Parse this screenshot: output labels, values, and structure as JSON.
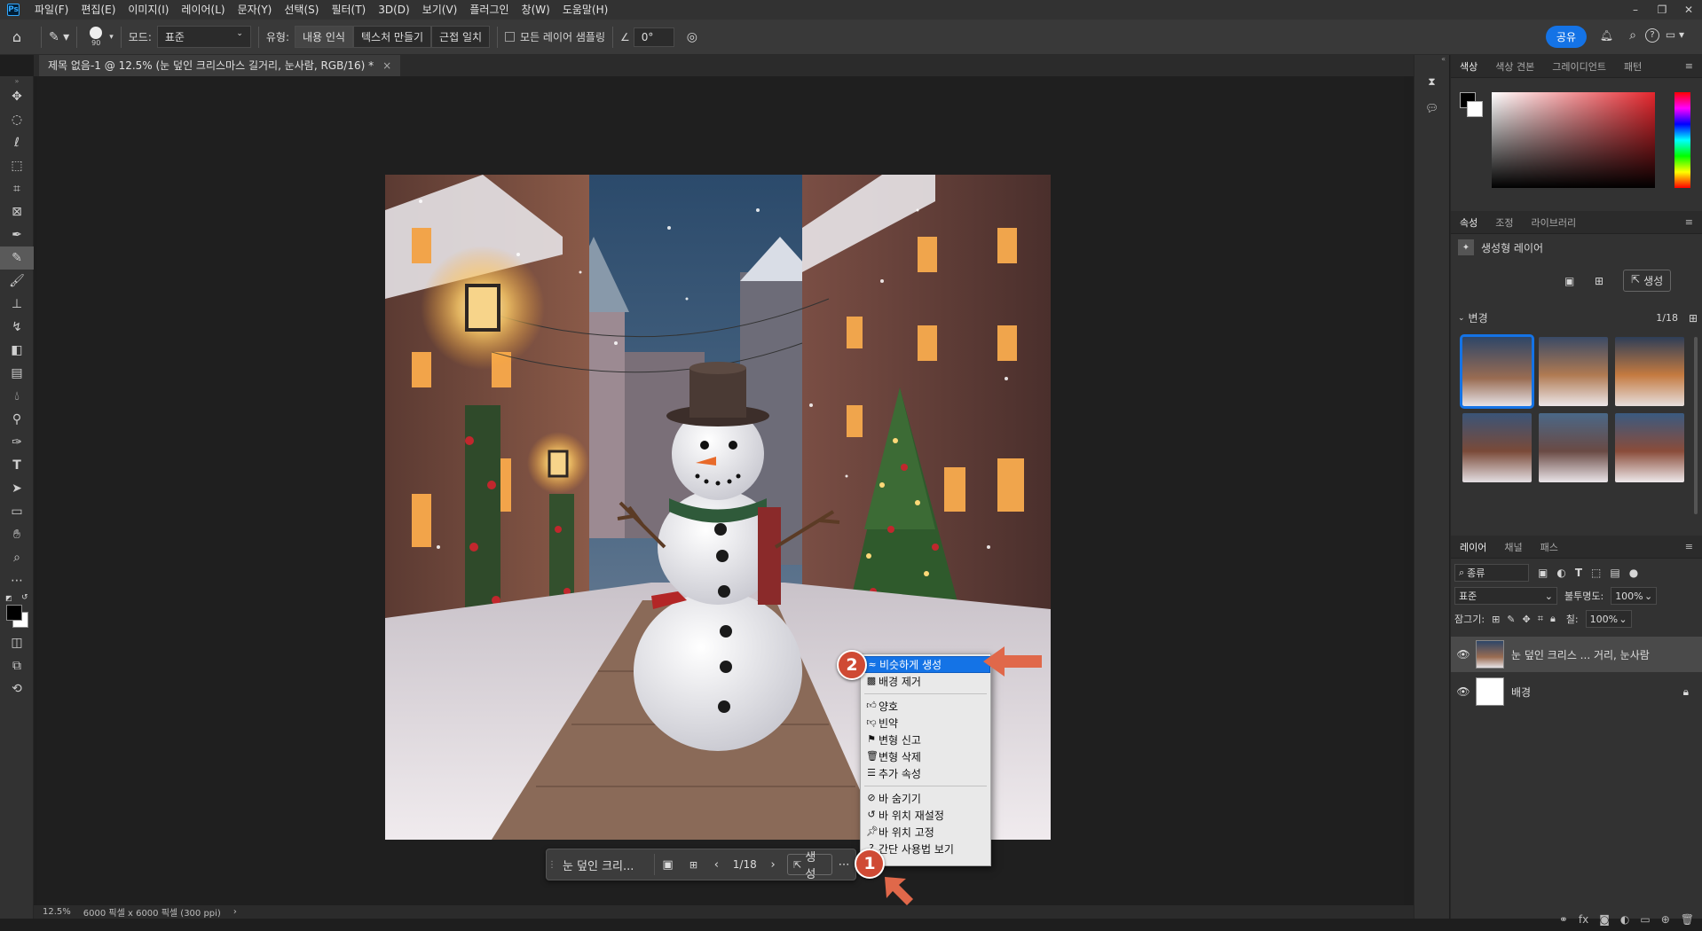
{
  "app": {
    "logo": "Ps"
  },
  "menubar": {
    "items": [
      "파일(F)",
      "편집(E)",
      "이미지(I)",
      "레이어(L)",
      "문자(Y)",
      "선택(S)",
      "필터(T)",
      "3D(D)",
      "보기(V)",
      "플러그인",
      "창(W)",
      "도움말(H)"
    ]
  },
  "window_controls": [
    "–",
    "❐",
    "✕"
  ],
  "options": {
    "brush_size": "90",
    "mode_label": "모드:",
    "mode_value": "표준",
    "type_label": "유형:",
    "type_buttons": [
      "내용 인식",
      "텍스처 만들기",
      "근접 일치"
    ],
    "sample_all_layers": "모든 레이어 샘플링",
    "angle": "0°",
    "share_button": "공유"
  },
  "document": {
    "tab_title": "제목 없음-1 @ 12.5% (눈 덮인 크리스마스 길거리, 눈사람, RGB/16) *",
    "close": "×"
  },
  "statusbar": {
    "zoom": "12.5%",
    "info": "6000 픽셀 x 6000 픽셀 (300 ppi)",
    "arrow": "›"
  },
  "contextbar": {
    "prompt": "눈 덮인 크리...",
    "counter": "1/18",
    "generate": "생성"
  },
  "context_menu": {
    "items": [
      {
        "label": "비슷하게 생성",
        "icon": "similar-icon"
      },
      {
        "label": "배경 제거",
        "icon": "remove-bg-icon"
      },
      {
        "label": "양호",
        "icon": "thumbs-up-icon"
      },
      {
        "label": "빈약",
        "icon": "thumbs-down-icon"
      },
      {
        "label": "변형 신고",
        "icon": "flag-icon"
      },
      {
        "label": "변형 삭제",
        "icon": "trash-icon"
      },
      {
        "label": "추가 속성",
        "icon": "sliders-icon"
      },
      {
        "label": "바 숨기기",
        "icon": "hide-icon"
      },
      {
        "label": "바 위치 재설정",
        "icon": "reset-icon"
      },
      {
        "label": "바 위치 고정",
        "icon": "pin-icon"
      },
      {
        "label": "간단 사용법 보기",
        "icon": "help-icon"
      }
    ]
  },
  "badges": {
    "one": "1",
    "two": "2"
  },
  "color_panel": {
    "tabs": [
      "색상",
      "색상 견본",
      "그레이디언트",
      "패턴"
    ]
  },
  "properties_panel": {
    "tabs": [
      "속성",
      "조정",
      "라이브러리"
    ],
    "layer_type": "생성형 레이어",
    "generate_button": "생성",
    "variations_label": "변경",
    "variations_counter": "1/18"
  },
  "layers_panel": {
    "tabs": [
      "레이어",
      "채널",
      "패스"
    ],
    "filter_kind": "종류",
    "blend_mode": "표준",
    "opacity_label": "불투명도:",
    "opacity_value": "100%",
    "lock_label": "잠그기:",
    "fill_label": "칠:",
    "fill_value": "100%",
    "layers": [
      {
        "name": "눈 덮인 크리스 ... 거리, 눈사람",
        "selected": true
      },
      {
        "name": "배경",
        "locked": true
      }
    ]
  },
  "colors": {
    "accent": "#1473e6",
    "badge": "#cf4a34",
    "panel": "#323232",
    "canvas_bg": "#1f1f1f"
  }
}
